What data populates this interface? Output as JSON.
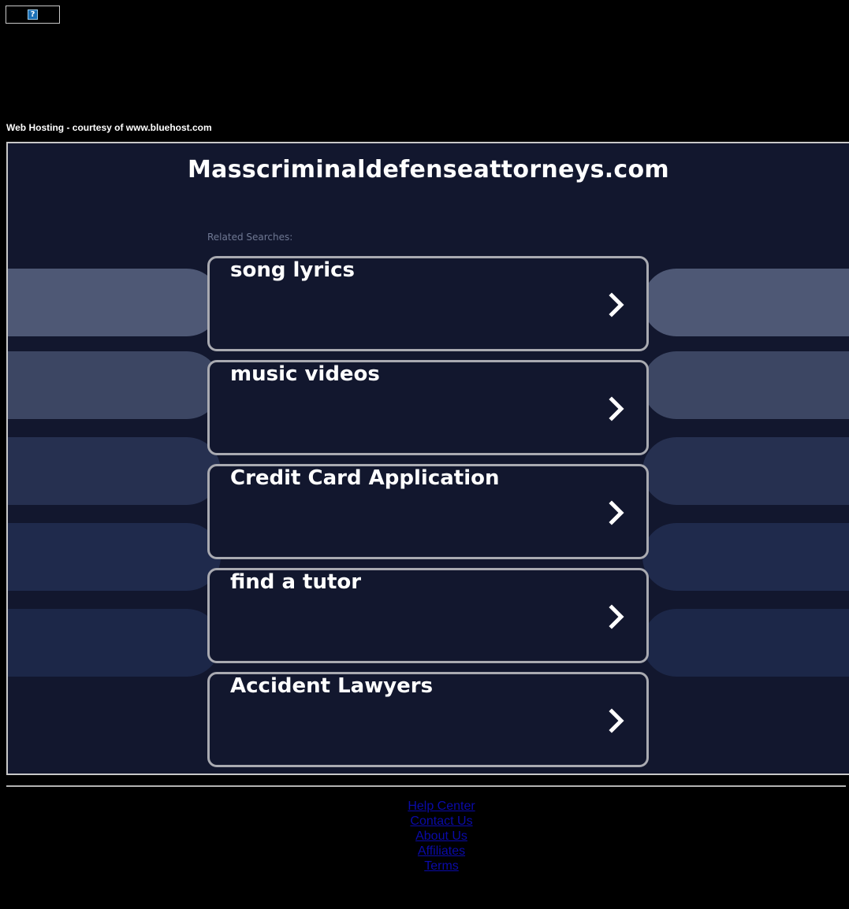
{
  "top_ad": {
    "icon": "broken-image-icon",
    "placeholder_glyph": "?"
  },
  "hosting_credit": "Web Hosting - courtesy of www.bluehost.com",
  "domain": "Masscriminaldefenseattorneys.com",
  "related_label": "Related Searches:",
  "related_searches": [
    {
      "label": "song lyrics",
      "icon": "chevron-right-icon"
    },
    {
      "label": "music videos",
      "icon": "chevron-right-icon"
    },
    {
      "label": "Credit Card Application",
      "icon": "chevron-right-icon"
    },
    {
      "label": "find a tutor",
      "icon": "chevron-right-icon"
    },
    {
      "label": "Accident Lawyers",
      "icon": "chevron-right-icon"
    }
  ],
  "footer": {
    "links": [
      "Help Center",
      "Contact Us",
      "About Us",
      "Affiliates",
      "Terms"
    ]
  },
  "colors": {
    "page_background": "#000000",
    "panel_background": "#12172e",
    "card_border": "#a9aab1",
    "link": "#0a0aa8",
    "related_label": "#6f7893"
  }
}
